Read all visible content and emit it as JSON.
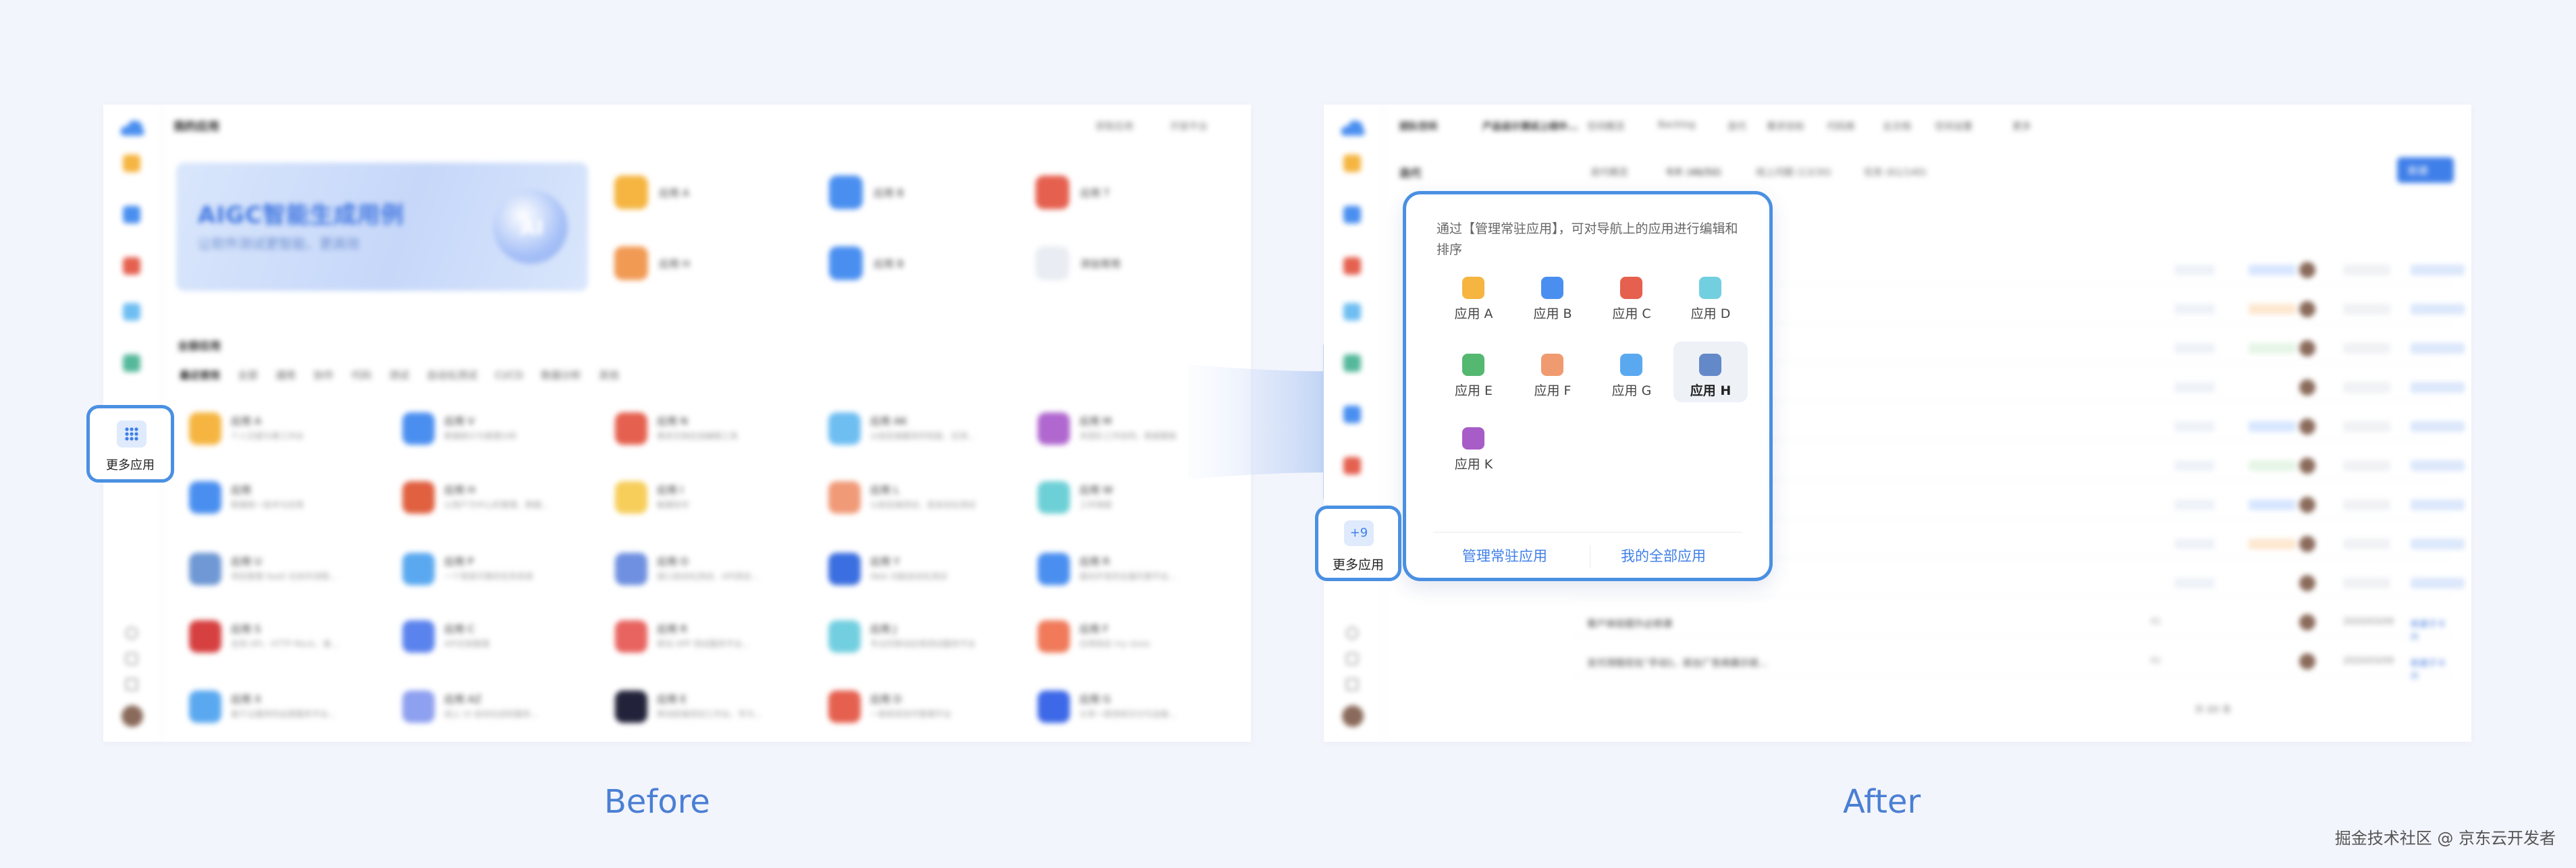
{
  "colors": {
    "highlight": "#4a90e2",
    "link": "#3f7fe9",
    "caption": "#4a7fd4",
    "background": "#f3f5fc"
  },
  "before": {
    "page_title": "我的应用",
    "top_links": [
      "获取应用",
      "开放平台"
    ],
    "banner": {
      "title": "AIGC智能生成用例",
      "subtitle": "让软件测试更智能、更高效",
      "orb_text": "AI"
    },
    "quick_apps": [
      {
        "label": "应用 A",
        "color": "#f5b540"
      },
      {
        "label": "应用 B",
        "color": "#4a8ff0"
      },
      {
        "label": "应用 T",
        "color": "#e5604f"
      },
      {
        "label": "应用 H",
        "color": "#f19a54"
      },
      {
        "label": "应用 B",
        "color": "#4a8ff0"
      },
      {
        "label": "添加常用",
        "color": "#e9ecf2"
      }
    ],
    "all_apps_title": "全部应用",
    "tabs": [
      "最近使用",
      "全部",
      "通用",
      "协作",
      "代码",
      "测试",
      "自动化测试",
      "CI/CD",
      "数据分析",
      "其他"
    ],
    "apps": [
      {
        "name": "应用 A",
        "desc": "个人日报与事工作台",
        "color": "#f5b540"
      },
      {
        "name": "应用 V",
        "desc": "数据统计与管理分析",
        "color": "#4a8ff0"
      },
      {
        "name": "应用 N",
        "desc": "需求文档在线编辑工具",
        "color": "#e5604f"
      },
      {
        "name": "应用 AK",
        "desc": "以前后端服务的性能、压测...",
        "color": "#6ebef2"
      },
      {
        "name": "应用 M",
        "desc": "多团队工作协同，数据看板",
        "color": "#b067cf"
      },
      {
        "name": "应用",
        "desc": "数据统一技术与应用",
        "color": "#4a8ff0"
      },
      {
        "name": "应用 H",
        "desc": "以用户为中心的管理、数据...",
        "color": "#e06040"
      },
      {
        "name": "应用 I",
        "desc": "敏捷协作",
        "color": "#f7ce5a"
      },
      {
        "name": "应用 L",
        "desc": "以前后端测试，是自动化测试",
        "color": "#f09a78"
      },
      {
        "name": "应用 W",
        "desc": "工时填报",
        "color": "#6dd0d6"
      },
      {
        "name": "应用 U",
        "desc": "项目管理 SaaS 化协作流程...",
        "color": "#6f98d4"
      },
      {
        "name": "应用 P",
        "desc": "一个简易可靠的任务系统",
        "color": "#5aa9f0"
      },
      {
        "name": "应用 O",
        "desc": "接口自动化测试、API测试...",
        "color": "#6f90e0"
      },
      {
        "name": "应用 Y",
        "desc": "Web 功能自动化测试",
        "color": "#3b6ee0"
      },
      {
        "name": "应用 R",
        "desc": "面向开发的全量托管平台...",
        "color": "#4a8ff0"
      },
      {
        "name": "应用 S",
        "desc": "支持 API、HTTP Mock、客...",
        "color": "#d64040"
      },
      {
        "name": "应用 C",
        "desc": "API文档管理",
        "color": "#5b83ee"
      },
      {
        "name": "应用 R",
        "desc": "移动 APP 测试服务平台...",
        "color": "#e86460"
      },
      {
        "name": "应用 J",
        "desc": "专业的移动应用测试服务平台",
        "color": "#72cfe0"
      },
      {
        "name": "应用 F",
        "desc": "应用商店 my store",
        "color": "#f07a5a"
      },
      {
        "name": "应用 X",
        "desc": "基于云服务的运营服务平台...",
        "color": "#5aa9f0"
      },
      {
        "name": "应用 AZ",
        "desc": "线上 UI 自动化巡检服务...",
        "color": "#8ea0f0"
      },
      {
        "name": "应用 E",
        "desc": "移动前端测试工作台，专为...",
        "color": "#22233a"
      },
      {
        "name": "应用 D",
        "desc": "一款研发协作管理平台",
        "color": "#e5604f"
      },
      {
        "name": "应用 G",
        "desc": "分享一款持续交付与运维...",
        "color": "#3d68e8"
      }
    ],
    "more_apps_label": "更多应用"
  },
  "after": {
    "header_tabs": [
      "团队空间",
      "产品设计测试上线中...",
      "空间概览",
      "Backlog",
      "迭代",
      "需求目标",
      "代码库",
      "云文档",
      "空间设置",
      "更多"
    ],
    "iteration_title": "迭代",
    "sub_tabs": [
      "迭代概览",
      "卡片 (46/50)",
      "线上问题 (13/30)",
      "任务 (61/140)"
    ],
    "new_button": "新建",
    "rows": [
      {
        "title": "客户体验提升必修课",
        "priority": "P2",
        "date": "2020/03/09",
        "action": "新建子卡片"
      },
      {
        "title": "支付流程优化“手动1，前台广告商展示就...",
        "priority": "P2",
        "date": "2020/03/09",
        "action": "新建子卡片"
      }
    ],
    "pagination": "共 89 条",
    "popup": {
      "description": "通过【管理常驻应用】，可对导航上的应用进行编辑和排序",
      "apps": [
        {
          "label": "应用 A",
          "color": "#f5b540"
        },
        {
          "label": "应用 B",
          "color": "#4a8ff0"
        },
        {
          "label": "应用 C",
          "color": "#e5604f"
        },
        {
          "label": "应用 D",
          "color": "#72cfe0"
        },
        {
          "label": "应用 E",
          "color": "#55b870"
        },
        {
          "label": "应用 F",
          "color": "#f09a70"
        },
        {
          "label": "应用 G",
          "color": "#5aa9f0"
        },
        {
          "label": "应用 H",
          "color": "#6489c8"
        },
        {
          "label": "应用 K",
          "color": "#a85cc8"
        }
      ],
      "manage_link": "管理常驻应用",
      "all_link": "我的全部应用"
    },
    "more_badge": "+9",
    "more_apps_label": "更多应用"
  },
  "captions": {
    "before": "Before",
    "after": "After"
  },
  "watermark": "掘金技术社区 @ 京东云开发者"
}
